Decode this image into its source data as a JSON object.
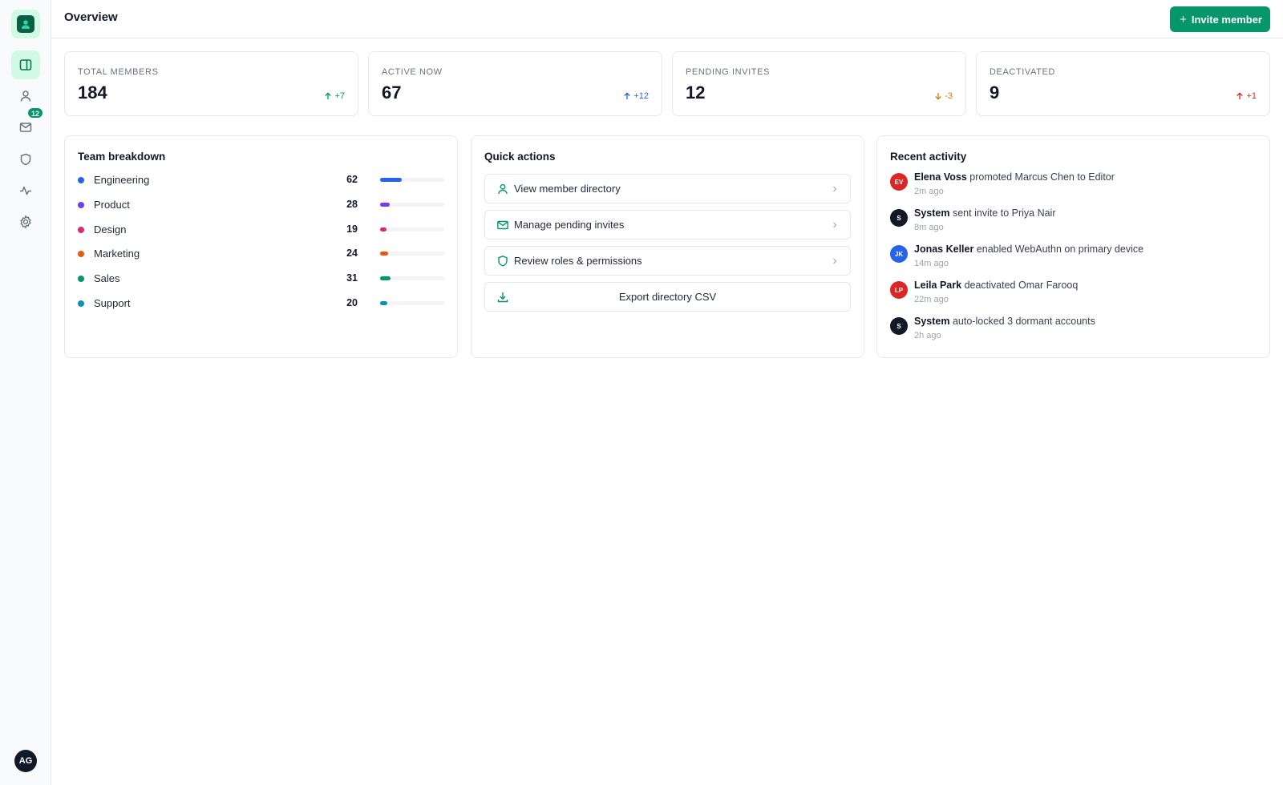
{
  "header": {
    "title": "Overview",
    "invite_label": "Invite member"
  },
  "sidebar": {
    "avatar_initials": "AG",
    "inbox_badge": "12",
    "items": [
      {
        "icon": "sidebar-layout-icon",
        "active": true
      },
      {
        "icon": "user-icon",
        "active": false
      },
      {
        "icon": "mail-icon",
        "active": false
      },
      {
        "icon": "shield-icon",
        "active": false
      },
      {
        "icon": "activity-icon",
        "active": false
      },
      {
        "icon": "gear-icon",
        "active": false
      }
    ]
  },
  "stats": [
    {
      "label": "TOTAL MEMBERS",
      "value": "184",
      "delta": "+7",
      "direction": "up",
      "color": "#059669"
    },
    {
      "label": "ACTIVE NOW",
      "value": "67",
      "delta": "+12",
      "direction": "up",
      "color": "#2563eb"
    },
    {
      "label": "PENDING INVITES",
      "value": "12",
      "delta": "-3",
      "direction": "down",
      "color": "#d97706"
    },
    {
      "label": "DEACTIVATED",
      "value": "9",
      "delta": "+1",
      "direction": "up",
      "color": "#dc2626"
    }
  ],
  "team_breakdown": {
    "title": "Team breakdown",
    "max": 184,
    "teams": [
      {
        "name": "Engineering",
        "count": "62",
        "color": "#2563eb"
      },
      {
        "name": "Product",
        "count": "28",
        "color": "#7c3aed"
      },
      {
        "name": "Design",
        "count": "19",
        "color": "#db2777"
      },
      {
        "name": "Marketing",
        "count": "24",
        "color": "#ea580c"
      },
      {
        "name": "Sales",
        "count": "31",
        "color": "#059669"
      },
      {
        "name": "Support",
        "count": "20",
        "color": "#0891b2"
      }
    ]
  },
  "quick_actions": {
    "title": "Quick actions",
    "items": [
      {
        "label": "View member directory",
        "icon": "user-icon"
      },
      {
        "label": "Manage pending invites",
        "icon": "mail-icon"
      },
      {
        "label": "Review roles & permissions",
        "icon": "shield-icon"
      },
      {
        "label": "Export directory CSV",
        "icon": "download-icon"
      }
    ]
  },
  "recent_activity": {
    "title": "Recent activity",
    "items": [
      {
        "initials": "EV",
        "avatar_color": "#dc2626",
        "actor": "Elena Voss",
        "text": "promoted Marcus Chen to Editor",
        "time": "2m ago"
      },
      {
        "initials": "S",
        "avatar_color": "#111827",
        "actor": "System",
        "text": "sent invite to Priya Nair",
        "time": "8m ago"
      },
      {
        "initials": "JK",
        "avatar_color": "#2563eb",
        "actor": "Jonas Keller",
        "text": "enabled WebAuthn on primary device",
        "time": "14m ago"
      },
      {
        "initials": "LP",
        "avatar_color": "#dc2626",
        "actor": "Leila Park",
        "text": "deactivated Omar Farooq",
        "time": "22m ago"
      },
      {
        "initials": "S",
        "avatar_color": "#111827",
        "actor": "System",
        "text": "auto-locked 3 dormant accounts",
        "time": "2h ago"
      }
    ]
  }
}
